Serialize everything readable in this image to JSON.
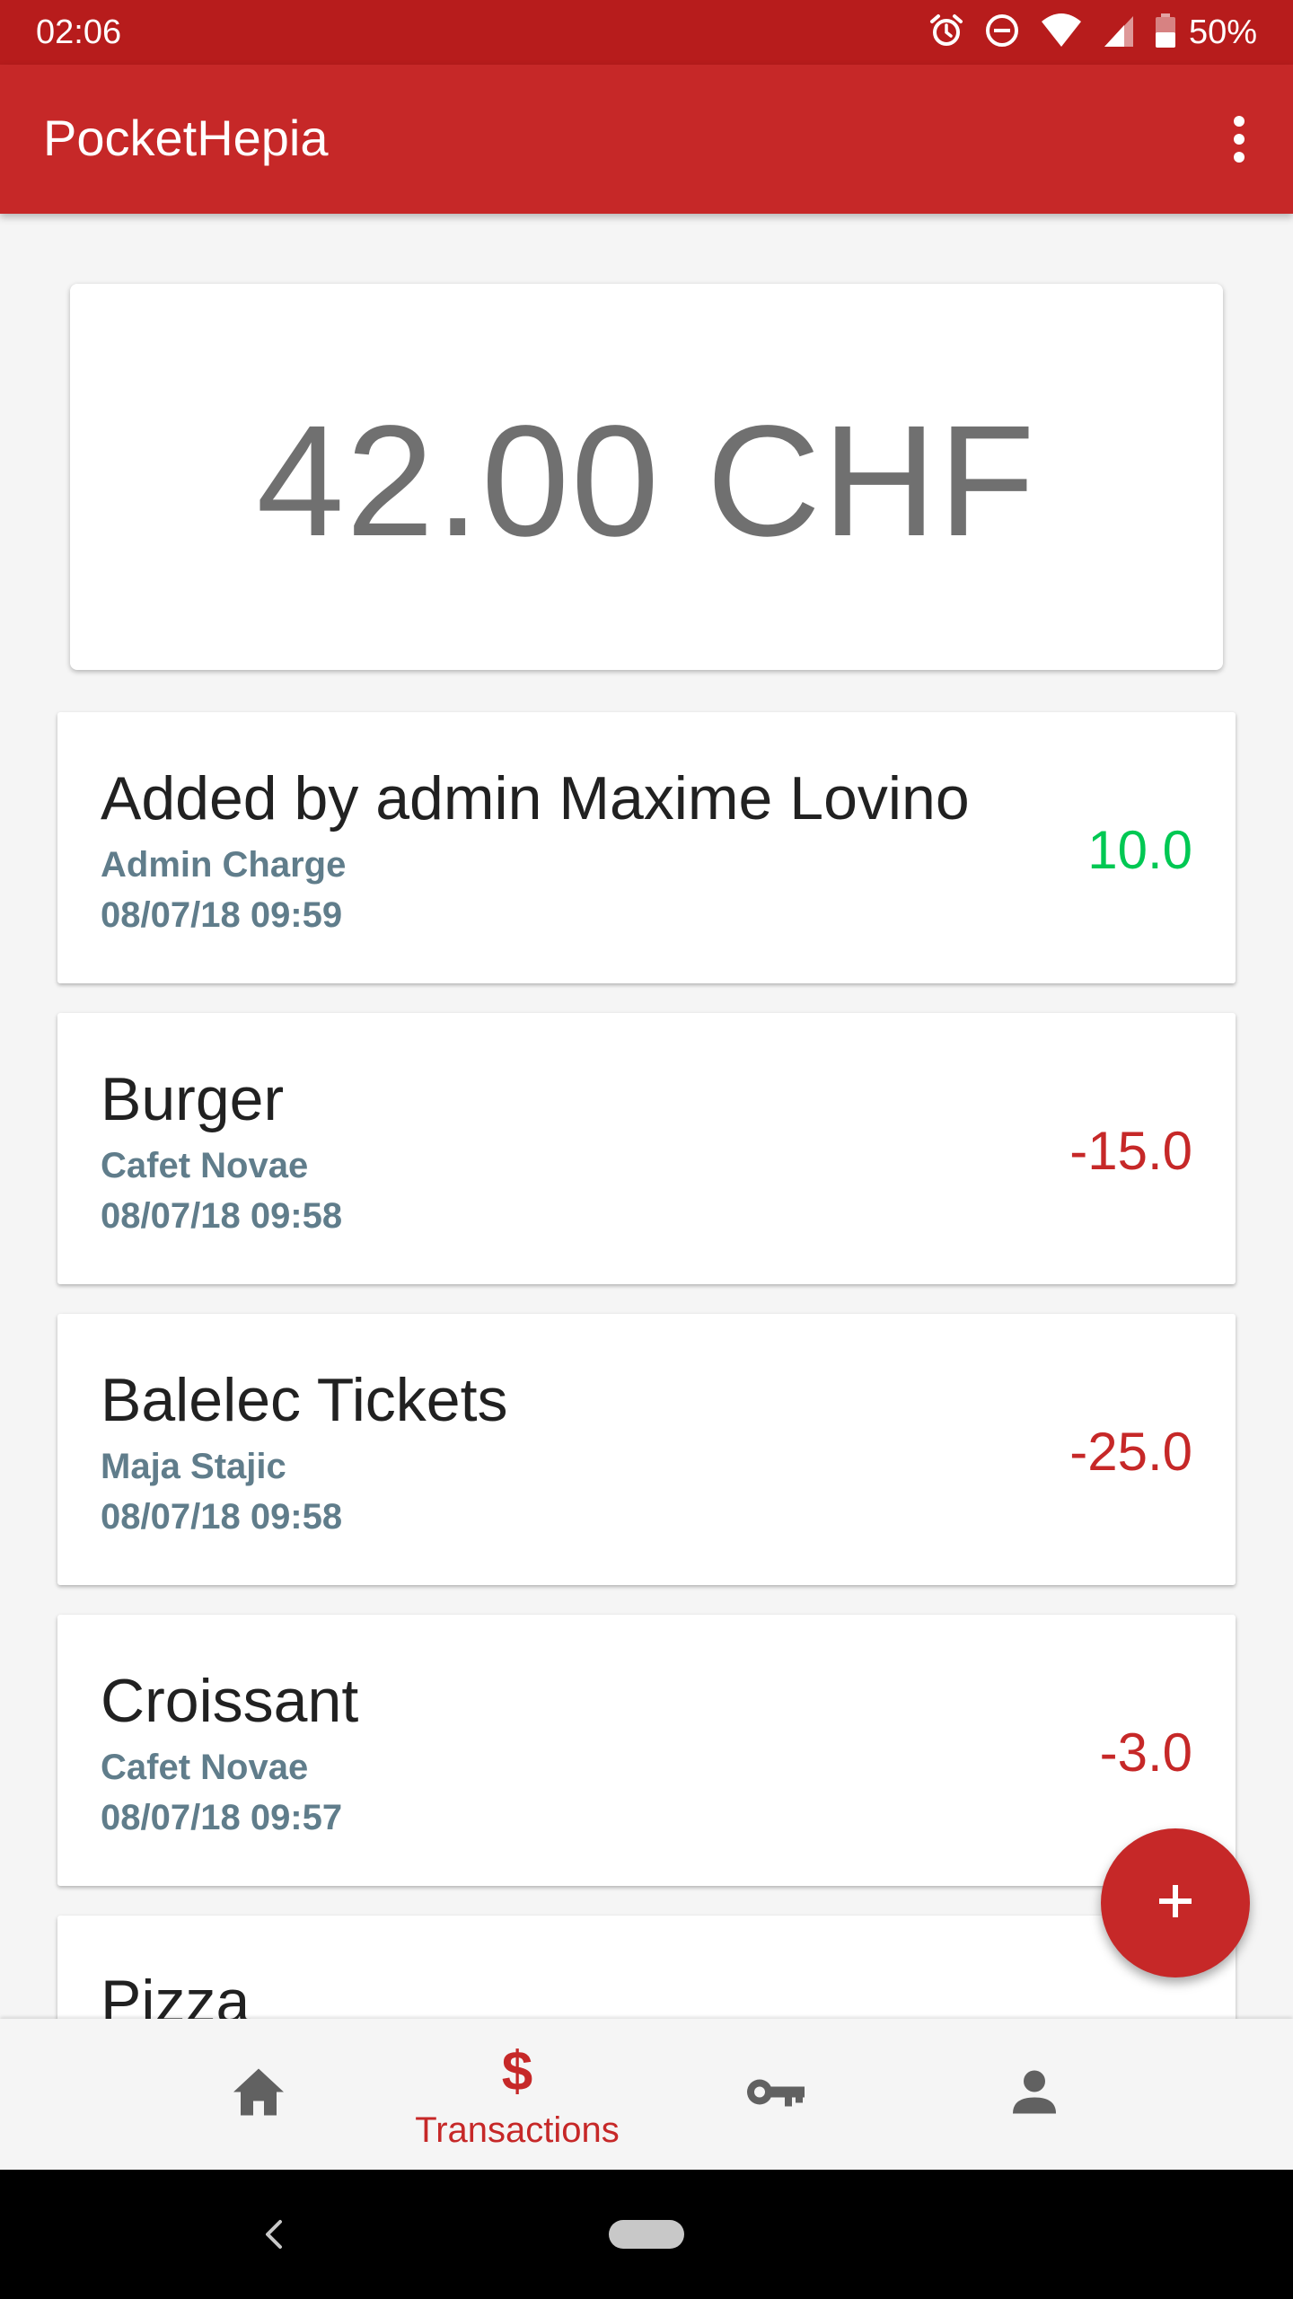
{
  "status_bar": {
    "time": "02:06",
    "battery_percent": "50%",
    "icons": [
      "alarm-icon",
      "do-not-disturb-icon",
      "wifi-icon",
      "cell-signal-icon",
      "battery-icon"
    ]
  },
  "app_bar": {
    "title": "PocketHepia",
    "menu_icon": "more-vert-icon"
  },
  "balance": {
    "amount": "42.00 CHF"
  },
  "transactions": [
    {
      "title": "Added by admin Maxime Lovino",
      "seller": "Admin Charge",
      "date": "08/07/18 09:59",
      "amount": "10.0",
      "type": "credit"
    },
    {
      "title": "Burger",
      "seller": "Cafet Novae",
      "date": "08/07/18 09:58",
      "amount": "-15.0",
      "type": "debit"
    },
    {
      "title": "Balelec Tickets",
      "seller": "Maja Stajic",
      "date": "08/07/18 09:58",
      "amount": "-25.0",
      "type": "debit"
    },
    {
      "title": "Croissant",
      "seller": "Cafet Novae",
      "date": "08/07/18 09:57",
      "amount": "-3.0",
      "type": "debit"
    },
    {
      "title": "Pizza",
      "seller": "",
      "date": "",
      "amount": "",
      "type": "debit"
    }
  ],
  "fab": {
    "icon": "plus-icon"
  },
  "bottom_nav": {
    "items": [
      {
        "id": "home",
        "icon": "home-icon",
        "label": "",
        "active": false
      },
      {
        "id": "transactions",
        "icon": "dollar-icon",
        "label": "Transactions",
        "active": true
      },
      {
        "id": "keys",
        "icon": "key-icon",
        "label": "",
        "active": false
      },
      {
        "id": "profile",
        "icon": "person-icon",
        "label": "",
        "active": false
      }
    ]
  },
  "colors": {
    "status_bar": "#b71c1c",
    "app_bar": "#c62828",
    "accent": "#c62828",
    "credit": "#00c853",
    "debit": "#c62828",
    "secondary_text": "#607d8b",
    "inactive_icon": "#616161"
  }
}
